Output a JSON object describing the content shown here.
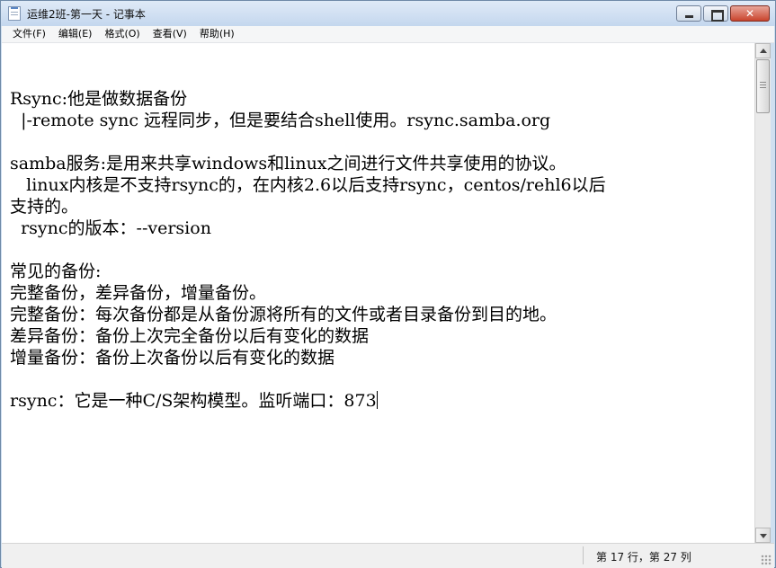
{
  "window": {
    "title": "运维2班-第一天 - 记事本"
  },
  "menu": {
    "items": [
      {
        "label": "文件(F)"
      },
      {
        "label": "编辑(E)"
      },
      {
        "label": "格式(O)"
      },
      {
        "label": "查看(V)"
      },
      {
        "label": "帮助(H)"
      }
    ]
  },
  "editor": {
    "lines": [
      "Rsync:他是做数据备份",
      "  |-remote sync 远程同步，但是要结合shell使用。rsync.samba.org",
      "",
      "samba服务:是用来共享windows和linux之间进行文件共享使用的协议。",
      "   linux内核是不支持rsync的，在内核2.6以后支持rsync，centos/rehl6以后",
      "支持的。",
      "  rsync的版本：--version",
      "",
      "常见的备份:",
      "完整备份，差异备份，增量备份。",
      "完整备份：每次备份都是从备份源将所有的文件或者目录备份到目的地。",
      "差异备份：备份上次完全备份以后有变化的数据",
      "增量备份：备份上次备份以后有变化的数据",
      "",
      "rsync：它是一种C/S架构模型。监听端口：873"
    ]
  },
  "statusbar": {
    "position": "第 17 行，第 27 列"
  },
  "icons": {
    "app": "notepad-icon",
    "minimize": "minimize-icon",
    "maximize": "maximize-icon",
    "close": "close-icon",
    "scroll_up": "arrow-up-icon",
    "scroll_down": "arrow-down-icon",
    "resize": "resize-grip-icon"
  },
  "colors": {
    "close_button": "#c9442d",
    "titlebar": "#cfdff0",
    "menubar": "#f5f6f7"
  }
}
